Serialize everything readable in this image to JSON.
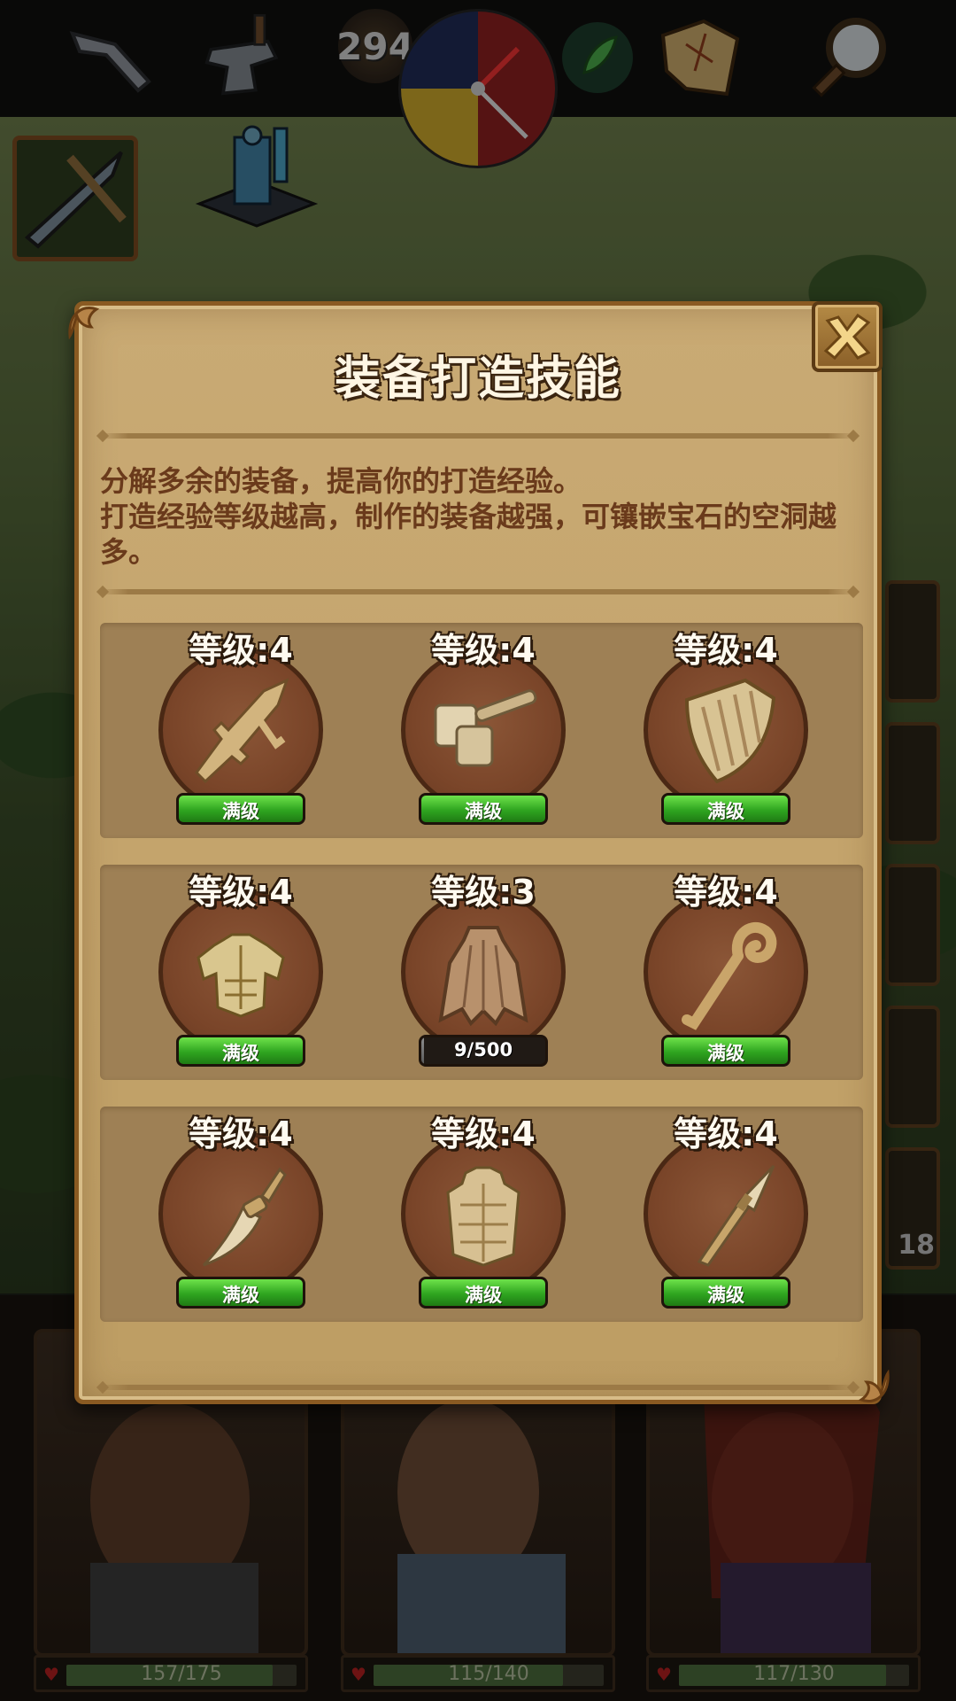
{
  "top_bar": {
    "coin_count": "294",
    "icons": [
      "crossbow-icon",
      "anvil-icon",
      "compass-icon",
      "herb-icon",
      "treasure-map-icon",
      "magnifier-icon"
    ]
  },
  "dialog": {
    "title": "装备打造技能",
    "description": [
      "分解多余的装备，提高你的打造经验。",
      "打造经验等级越高，制作的装备越强，可镶嵌宝石的空洞越多。"
    ],
    "skills": [
      {
        "icon": "sword-icon",
        "level_text": "等级:4",
        "bar_text": "满级",
        "progress": 1.0
      },
      {
        "icon": "hammer-icon",
        "level_text": "等级:4",
        "bar_text": "满级",
        "progress": 1.0
      },
      {
        "icon": "shield-icon",
        "level_text": "等级:4",
        "bar_text": "满级",
        "progress": 1.0
      },
      {
        "icon": "plate-armor-icon",
        "level_text": "等级:4",
        "bar_text": "满级",
        "progress": 1.0
      },
      {
        "icon": "cloak-icon",
        "level_text": "等级:3",
        "bar_text": "9/500",
        "progress": 0.018
      },
      {
        "icon": "staff-icon",
        "level_text": "等级:4",
        "bar_text": "满级",
        "progress": 1.0
      },
      {
        "icon": "dagger-icon",
        "level_text": "等级:4",
        "bar_text": "满级",
        "progress": 1.0
      },
      {
        "icon": "leather-armor-icon",
        "level_text": "等级:4",
        "bar_text": "满级",
        "progress": 1.0
      },
      {
        "icon": "spear-icon",
        "level_text": "等级:4",
        "bar_text": "满级",
        "progress": 1.0
      }
    ]
  },
  "heroes": [
    {
      "hp_text": "157/175",
      "hp": 157,
      "hp_max": 175
    },
    {
      "hp_text": "115/140",
      "hp": 115,
      "hp_max": 140
    },
    {
      "hp_text": "117/130",
      "hp": 117,
      "hp_max": 130
    }
  ],
  "side_badge": "18",
  "colors": {
    "panel": "#c4a46c",
    "panel_border": "#8a5a22",
    "description_text": "#6a3a1b",
    "skill_row": "#9e8055",
    "skill_circle": "#7a4529",
    "max_bar": "#2fa520",
    "progress_bar": "#5a5a5a"
  }
}
